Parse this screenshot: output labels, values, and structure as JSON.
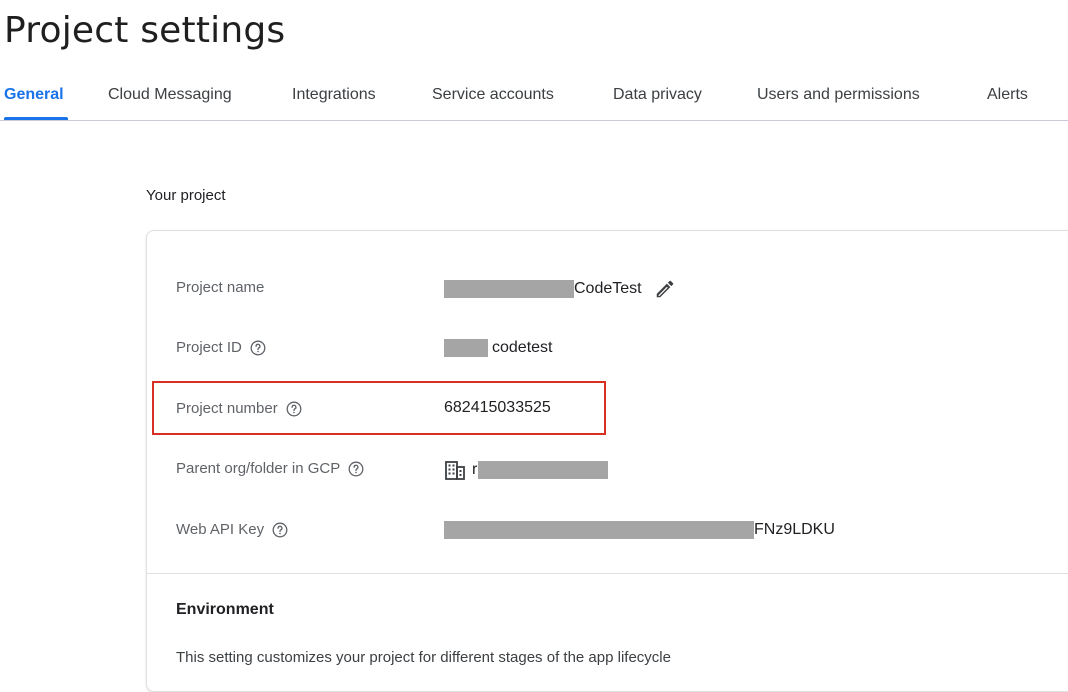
{
  "page": {
    "title": "Project settings"
  },
  "tabs": [
    {
      "label": "General",
      "active": true
    },
    {
      "label": "Cloud Messaging",
      "active": false
    },
    {
      "label": "Integrations",
      "active": false
    },
    {
      "label": "Service accounts",
      "active": false
    },
    {
      "label": "Data privacy",
      "active": false
    },
    {
      "label": "Users and permissions",
      "active": false
    },
    {
      "label": "Alerts",
      "active": false
    }
  ],
  "your_project": {
    "section_title": "Your project",
    "rows": {
      "project_name": {
        "label": "Project name",
        "value_visible": "CodeTest",
        "has_edit_icon": true,
        "redacted": true
      },
      "project_id": {
        "label": "Project ID",
        "value_visible": "codetest",
        "has_help_icon": true,
        "redacted": true
      },
      "project_number": {
        "label": "Project number",
        "value": "682415033525",
        "has_help_icon": true,
        "highlighted": true
      },
      "parent_org": {
        "label": "Parent org/folder in GCP",
        "value_visible": "r",
        "has_help_icon": true,
        "icon": "building-icon",
        "redacted": true
      },
      "web_api_key": {
        "label": "Web API Key",
        "value_visible": "FNz9LDKU",
        "has_help_icon": true,
        "redacted": true
      }
    }
  },
  "environment": {
    "title": "Environment",
    "description": "This setting customizes your project for different stages of the app lifecycle"
  },
  "colors": {
    "accent": "#1a73e8",
    "highlight_border": "#d93025",
    "redaction": "#a5a5a5",
    "label_text": "#5f6368"
  }
}
